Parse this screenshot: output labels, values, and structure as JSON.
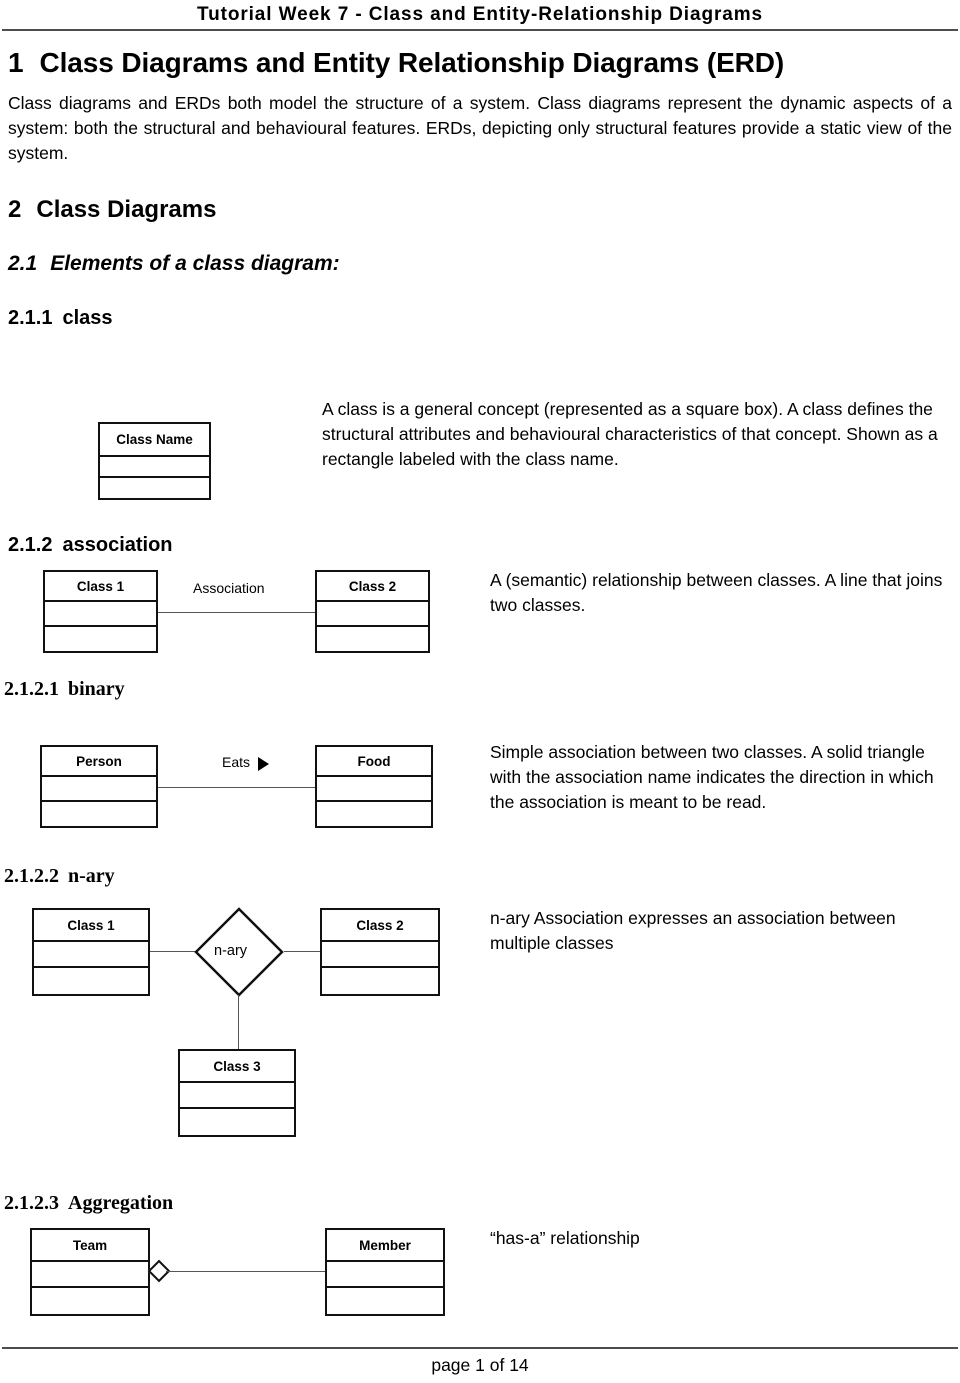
{
  "header": {
    "title": "Tutorial Week 7 - Class and Entity-Relationship Diagrams"
  },
  "sections": {
    "s1": {
      "num": "1",
      "title": "Class Diagrams and Entity Relationship  Diagrams (ERD)",
      "body": "Class diagrams and ERDs both model the structure of a system.  Class diagrams represent the dynamic aspects of a system: both the structural and behavioural features. ERDs, depicting only structural features  provide a static view of the system."
    },
    "s2": {
      "num": "2",
      "title": "Class Diagrams"
    },
    "s2_1": {
      "num": "2.1",
      "title": "Elements of a class diagram:"
    },
    "s2_1_1": {
      "num": "2.1.1",
      "title": "class"
    },
    "s2_1_2": {
      "num": "2.1.2",
      "title": "association"
    },
    "s2_1_2_1": {
      "num": "2.1.2.1",
      "title": "binary"
    },
    "s2_1_2_2": {
      "num": "2.1.2.2",
      "title": "n-ary"
    },
    "s2_1_2_3": {
      "num": "2.1.2.3",
      "title": "Aggregation"
    }
  },
  "diagrams": {
    "class_example": {
      "box_label": "Class Name",
      "description": "A class is a general concept (represented as a square box). A class defines the structural attributes and behavioural characteristics of that concept.  Shown as a  rectangle labeled with the class name."
    },
    "association": {
      "left_box": "Class 1",
      "right_box": "Class 2",
      "edge_label": "Association",
      "description": "A (semantic) relationship between classes. A line that joins two classes."
    },
    "binary": {
      "left_box": "Person",
      "right_box": "Food",
      "edge_label": "Eats",
      "direction_icon": "solid-right-triangle",
      "description": "Simple association between two classes.  A solid triangle with the  association name indicates the direction in which the association is meant to be read."
    },
    "nary": {
      "left_box": "Class 1",
      "right_box": "Class 2",
      "bottom_box": "Class 3",
      "diamond_label": "n-ary",
      "description": "n-ary Association  expresses an association between multiple classes"
    },
    "aggregation": {
      "left_box": "Team",
      "right_box": "Member",
      "connector_icon": "hollow-diamond",
      "description": "“has-a” relationship"
    }
  },
  "footer": {
    "page_label": "page 1 of 14"
  },
  "colors": {
    "text": "#000000",
    "rule": "#4d4d4d",
    "box_border": "#111111",
    "connector": "#555555"
  }
}
